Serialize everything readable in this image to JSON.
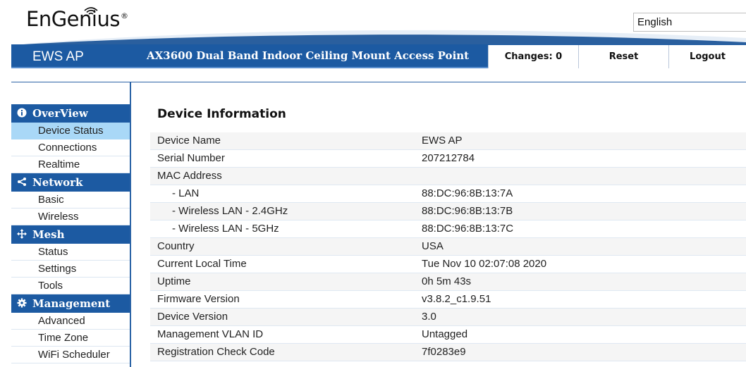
{
  "header": {
    "logo": "EnGenius",
    "logo_mark": "®",
    "language": "English",
    "product": "EWS AP",
    "model": "AX3600 Dual Band Indoor Ceiling Mount Access Point",
    "changes_label": "Changes: 0",
    "reset_label": "Reset",
    "logout_label": "Logout"
  },
  "sidebar": {
    "sections": [
      {
        "label": "OverView",
        "icon": "info-icon",
        "items": [
          "Device Status",
          "Connections",
          "Realtime"
        ]
      },
      {
        "label": "Network",
        "icon": "share-icon",
        "items": [
          "Basic",
          "Wireless"
        ]
      },
      {
        "label": "Mesh",
        "icon": "move-arrows-icon",
        "items": [
          "Status",
          "Settings",
          "Tools"
        ]
      },
      {
        "label": "Management",
        "icon": "gear-icon",
        "items": [
          "Advanced",
          "Time Zone",
          "WiFi Scheduler"
        ]
      }
    ],
    "active_item": "Device Status"
  },
  "main": {
    "title": "Device Information",
    "rows": [
      {
        "label": "Device Name",
        "value": "EWS AP"
      },
      {
        "label": "Serial Number",
        "value": "207212784"
      },
      {
        "label": "MAC Address",
        "value": ""
      },
      {
        "label": "- LAN",
        "value": "88:DC:96:8B:13:7A",
        "sub": true
      },
      {
        "label": "- Wireless LAN - 2.4GHz",
        "value": "88:DC:96:8B:13:7B",
        "sub": true
      },
      {
        "label": "- Wireless LAN - 5GHz",
        "value": "88:DC:96:8B:13:7C",
        "sub": true
      },
      {
        "label": "Country",
        "value": "USA"
      },
      {
        "label": "Current Local Time",
        "value": "Tue Nov 10 02:07:08 2020"
      },
      {
        "label": "Uptime",
        "value": "0h 5m 43s"
      },
      {
        "label": "Firmware Version",
        "value": "v3.8.2_c1.9.51"
      },
      {
        "label": "Device Version",
        "value": "3.0"
      },
      {
        "label": "Management VLAN ID",
        "value": "Untagged"
      },
      {
        "label": "Registration Check Code",
        "value": "7f0283e9"
      }
    ]
  },
  "colors": {
    "primary": "#1c5aa2",
    "active": "#a9d8f7"
  }
}
